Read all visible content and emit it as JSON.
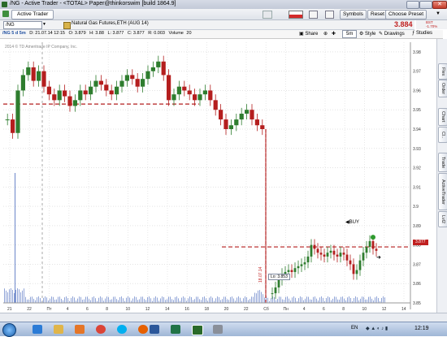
{
  "window": {
    "title": "/NG - Active Trader - <TOTAL> Paper@thinkorswim [build 1864.9]",
    "controls": [
      "minimize",
      "maximize",
      "close"
    ]
  },
  "toolbar_main": {
    "tab_label": "Active Trader",
    "symbols_label": "Symbols",
    "reset_label": "Reset",
    "preset_label": "Choose Preset"
  },
  "symbol_bar": {
    "symbol": "/NG",
    "description": "Natural Gas Futures,ETH (AUG 14)",
    "last_price": "3.884",
    "change_line1": "BST",
    "change_line2": "-1.70%"
  },
  "chart_toolbar": {
    "share_label": "Share",
    "timeframe_label": "5m",
    "style_label": "Style",
    "drawings_label": "Drawings",
    "studies_label": "Studies"
  },
  "chart_header": {
    "symbol_period": "/NG 5 d 5m",
    "date": "D: 21.07.14 12:15",
    "open": "O: 3.879",
    "high": "H: 3.88",
    "low": "L: 3.877",
    "close": "C: 3.877",
    "range": "R: 0.003",
    "volume": "Volume",
    "volume_value": "20",
    "copyright": "2014 © TD Ameritrade IP Company, Inc."
  },
  "side_tabs": [
    "Flex",
    "Order",
    "Chart",
    "Cl..",
    "Trade",
    "ActiveTrader",
    "Lvl2"
  ],
  "chart_data": {
    "type": "candlestick",
    "ylim": [
      3.85,
      3.985
    ],
    "yticks": [
      "3.98",
      "3.97",
      "3.96",
      "3.95",
      "3.94",
      "3.93",
      "3.92",
      "3.91",
      "3.9",
      "3.89",
      "3.88",
      "3.87",
      "3.86",
      "3.85"
    ],
    "xticks": [
      "21",
      "22",
      "Пт",
      "4",
      "6",
      "8",
      "10",
      "12",
      "14",
      "16",
      "18",
      "20",
      "22",
      "Сб",
      "Пн",
      "4",
      "6",
      "8",
      "10",
      "12",
      "14"
    ],
    "price_label": "3.877",
    "lo_label": "Lo: 3.853",
    "date_marker": "18.07.14",
    "buy_label": "BUY",
    "resistance_level_1": 3.953,
    "resistance_level_2": 3.879,
    "series": [
      {
        "segment": "friday",
        "closes": [
          3.945,
          3.938,
          3.96,
          3.968,
          3.972,
          3.965,
          3.97,
          3.962,
          3.958,
          3.955,
          3.96,
          3.957,
          3.952,
          3.955,
          3.96,
          3.958,
          3.962,
          3.965,
          3.963,
          3.96,
          3.958,
          3.962,
          3.965,
          3.968,
          3.966,
          3.962,
          3.966,
          3.97,
          3.972,
          3.975,
          3.968,
          3.955,
          3.958,
          3.962,
          3.96,
          3.958,
          3.955,
          3.958,
          3.96,
          3.955,
          3.95,
          3.945,
          3.94,
          3.942,
          3.945,
          3.948,
          3.95,
          3.945,
          3.942,
          3.94
        ]
      },
      {
        "segment": "monday",
        "closes": [
          3.855,
          3.858,
          3.862,
          3.865,
          3.866,
          3.867,
          3.866,
          3.868,
          3.869,
          3.87,
          3.871,
          3.874,
          3.88,
          3.878,
          3.876,
          3.875,
          3.874,
          3.876,
          3.877,
          3.875,
          3.874,
          3.876,
          3.875,
          3.872,
          3.87,
          3.865,
          3.867,
          3.872,
          3.876,
          3.879,
          3.882,
          3.878,
          3.877
        ]
      }
    ],
    "colors": {
      "up": "#2e7d2e",
      "down": "#b41e1e",
      "level": "#b41e1e",
      "volume": "#6b86c9",
      "price_tag": "#c02020"
    }
  },
  "taskbar": {
    "language": "EN",
    "time": "12:19"
  }
}
